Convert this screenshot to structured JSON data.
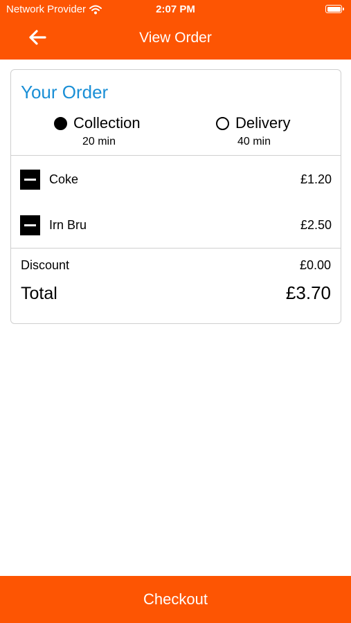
{
  "status_bar": {
    "carrier": "Network Provider",
    "time": "2:07 PM",
    "icons": [
      "wifi-icon",
      "battery-icon"
    ]
  },
  "nav": {
    "title": "View Order",
    "back_icon": "arrow-left-icon"
  },
  "order": {
    "heading": "Your Order",
    "options": [
      {
        "label": "Collection",
        "time": "20 min",
        "selected": true
      },
      {
        "label": "Delivery",
        "time": "40 min",
        "selected": false
      }
    ],
    "items": [
      {
        "name": "Coke",
        "price": "£1.20",
        "icon": "remove-icon"
      },
      {
        "name": "Irn Bru",
        "price": "£2.50",
        "icon": "remove-icon"
      }
    ],
    "discount_label": "Discount",
    "discount_value": "£0.00",
    "total_label": "Total",
    "total_value": "£3.70"
  },
  "checkout_label": "Checkout",
  "colors": {
    "brand": "#fd5503",
    "heading": "#1a8fd6",
    "border": "#cfcfcf"
  }
}
